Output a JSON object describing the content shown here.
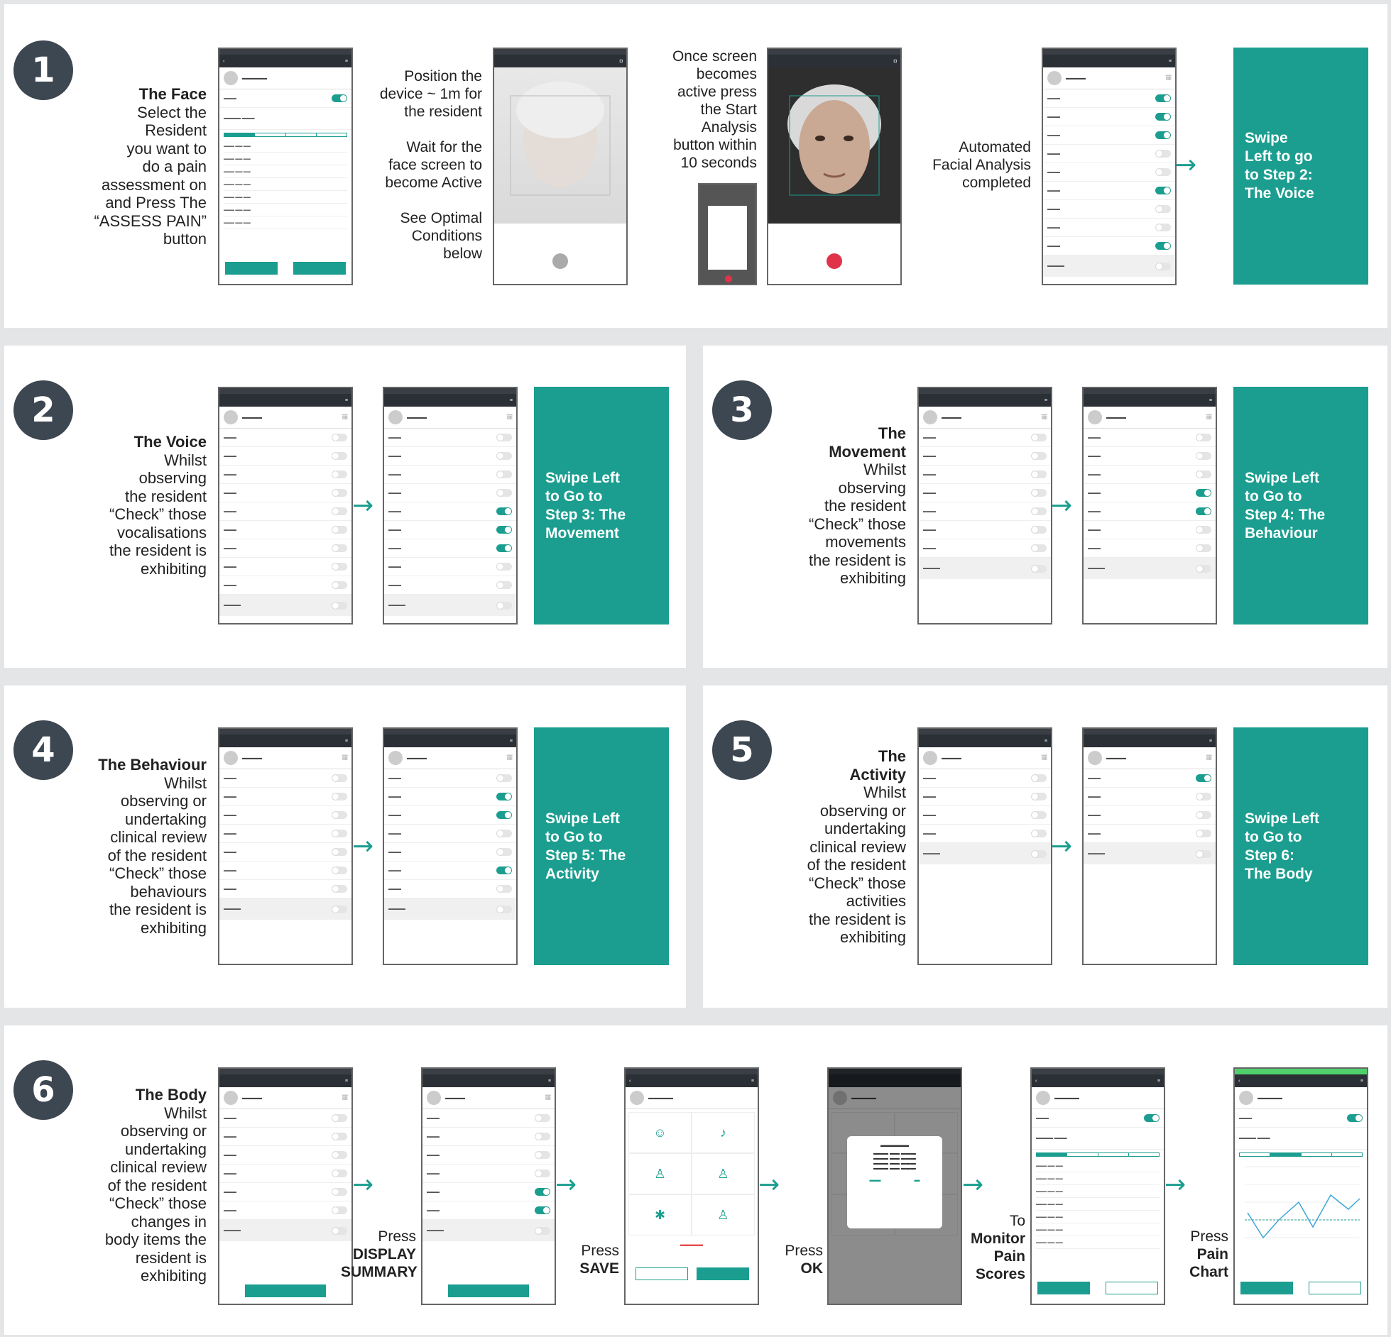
{
  "steps": {
    "s1": {
      "number": "1",
      "title": "The Face",
      "desc": [
        "Select the",
        "Resident",
        "you want to",
        "do a pain",
        "assessment on",
        "and Press The",
        "“ASSESS PAIN”",
        "button"
      ],
      "cap_position": [
        "Position the",
        "device ~ 1m for",
        "the resident",
        "",
        "Wait for the",
        "face screen to",
        "become Active",
        "",
        "See Optimal",
        "Conditions",
        "below"
      ],
      "cap_active": [
        "Once screen",
        "becomes",
        "active press",
        "the Start",
        "Analysis",
        "button within",
        "10 seconds"
      ],
      "cap_auto": [
        "Automated",
        "Facial Analysis",
        "completed"
      ],
      "swipe": [
        "Swipe",
        "Left to go",
        "to Step 2:",
        "The Voice"
      ]
    },
    "s2": {
      "number": "2",
      "title": "The Voice",
      "desc": [
        "Whilst",
        "observing",
        "the resident",
        "“Check” those",
        "vocalisations",
        "the resident is",
        "exhibiting"
      ],
      "swipe": [
        "Swipe Left",
        "to Go to",
        "Step 3: The",
        "Movement"
      ]
    },
    "s3": {
      "number": "3",
      "title": [
        "The",
        "Movement"
      ],
      "desc": [
        "Whilst",
        "observing",
        "the resident",
        "“Check” those",
        "movements",
        "the resident is",
        "exhibiting"
      ],
      "swipe": [
        "Swipe Left",
        "to Go to",
        "Step 4: The",
        "Behaviour"
      ]
    },
    "s4": {
      "number": "4",
      "title": "The Behaviour",
      "desc": [
        "Whilst",
        "observing or",
        "undertaking",
        "clinical review",
        "of the resident",
        "“Check” those",
        "behaviours",
        "the resident is",
        "exhibiting"
      ],
      "swipe": [
        "Swipe Left",
        "to Go to",
        "Step 5: The",
        "Activity"
      ]
    },
    "s5": {
      "number": "5",
      "title": [
        "The",
        "Activity"
      ],
      "desc": [
        "Whilst",
        "observing or",
        "undertaking",
        "clinical review",
        "of the resident",
        "“Check” those",
        "activities",
        "the resident is",
        "exhibiting"
      ],
      "swipe": [
        "Swipe Left",
        "to Go to",
        "Step 6:",
        "The Body"
      ]
    },
    "s6": {
      "number": "6",
      "title": "The Body",
      "desc": [
        "Whilst",
        "observing or",
        "undertaking",
        "clinical review",
        "of the resident",
        "“Check” those",
        "changes in",
        "body items the",
        "resident is",
        "exhibiting"
      ],
      "cap_display": {
        "pre": "Press",
        "bold": [
          "DISPLAY",
          "SUMMARY"
        ]
      },
      "cap_save": {
        "pre": "Press",
        "bold": [
          "SAVE"
        ]
      },
      "cap_ok": {
        "pre": "Press",
        "bold": [
          "OK"
        ]
      },
      "cap_monitor": {
        "pre": "To",
        "bold": [
          "Monitor",
          "Pain",
          "Scores"
        ]
      },
      "cap_chart": {
        "pre": "Press",
        "bold": [
          "Pain",
          "Chart"
        ]
      }
    }
  },
  "arrow_glyph": "→"
}
